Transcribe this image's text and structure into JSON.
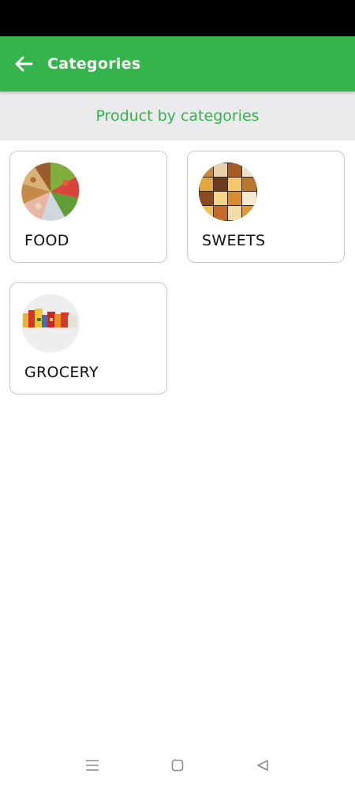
{
  "app_bar": {
    "title": "Categories",
    "back_icon": "arrow-left-icon",
    "background": "#34b44a"
  },
  "subheader": {
    "text": "Product by categories",
    "color": "#34b44a"
  },
  "categories": [
    {
      "label": "FOOD",
      "image": "food-platter-image"
    },
    {
      "label": "SWEETS",
      "image": "sweets-collage-image"
    },
    {
      "label": "GROCERY",
      "image": "grocery-packages-image"
    }
  ],
  "nav_bar": {
    "icons": [
      "menu-icon",
      "home-icon",
      "back-triangle-icon"
    ]
  }
}
